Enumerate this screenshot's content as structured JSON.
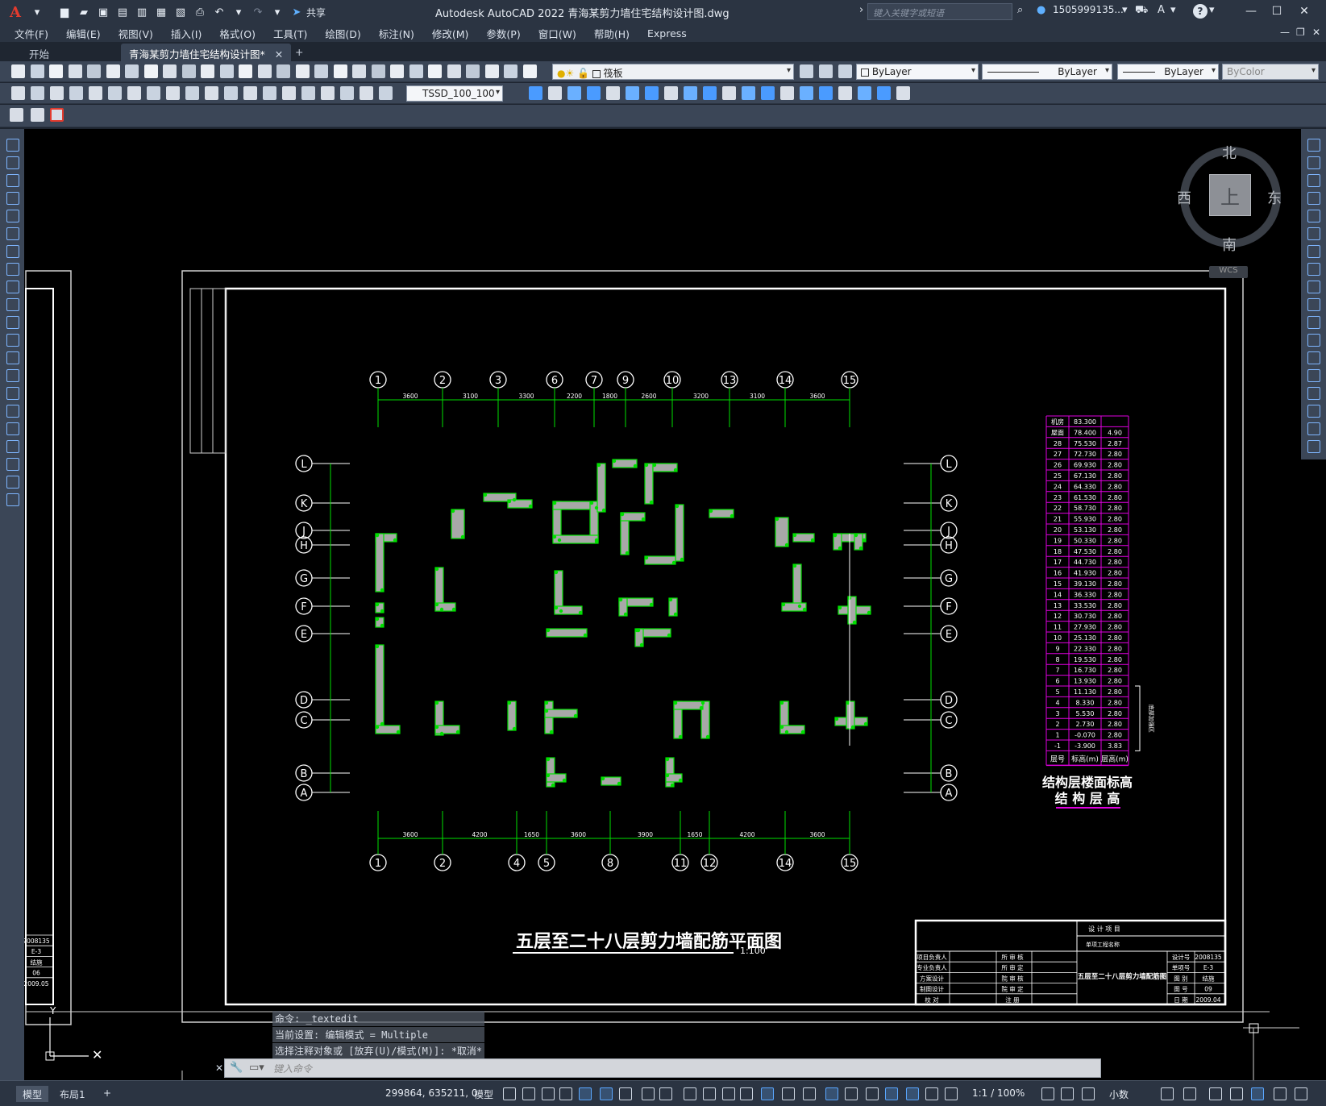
{
  "app": {
    "logo": "A",
    "title": "Autodesk AutoCAD 2022    青海某剪力墙住宅结构设计图.dwg",
    "share_label": "共享",
    "search_placeholder": "键入关键字或短语",
    "user": "1505999135...",
    "help": "?"
  },
  "menu": [
    "文件(F)",
    "编辑(E)",
    "视图(V)",
    "插入(I)",
    "格式(O)",
    "工具(T)",
    "绘图(D)",
    "标注(N)",
    "修改(M)",
    "参数(P)",
    "窗口(W)",
    "帮助(H)",
    "Express"
  ],
  "tabs": {
    "start": "开始",
    "active": "青海某剪力墙住宅结构设计图*",
    "add": "+"
  },
  "toolbar": {
    "layer_combo": "筏板",
    "text_style": "TSSD_100_100",
    "color_combo": "ByLayer",
    "linetype_combo": "ByLayer",
    "lineweight_combo": "ByLayer",
    "plotstyle_combo": "ByColor"
  },
  "viewcube": {
    "north": "北",
    "south": "南",
    "east": "东",
    "west": "西",
    "top": "上",
    "wcs": "WCS"
  },
  "drawing": {
    "title": "五层至二十八层剪力墙配筋平面图",
    "scale": "1:100",
    "grid_top": [
      "1",
      "2",
      "3",
      "6",
      "7",
      "9",
      "10",
      "13",
      "14",
      "15"
    ],
    "grid_bottom": [
      "1",
      "2",
      "4",
      "5",
      "8",
      "11",
      "12",
      "14",
      "15"
    ],
    "grid_left": [
      "L",
      "K",
      "J",
      "H",
      "G",
      "F",
      "E",
      "D",
      "C",
      "B",
      "A"
    ],
    "dims_top": [
      "3600",
      "3100",
      "3300",
      "2200",
      "1800",
      "2600",
      "3200",
      "3100",
      "3600"
    ],
    "dims_bottom": [
      "3600",
      "4200",
      "1650",
      "3600",
      "3900",
      "1650",
      "4200",
      "3600"
    ],
    "table_title_1": "结构层楼面标高",
    "table_title_2": "结 构 层 高",
    "table_headers": [
      "层号",
      "标高(m)",
      "层高(m)"
    ],
    "table_side": "底部加强区",
    "table_rows": [
      [
        "机房",
        "83.300",
        ""
      ],
      [
        "屋面",
        "78.400",
        "4.90"
      ],
      [
        "28",
        "75.530",
        "2.87"
      ],
      [
        "27",
        "72.730",
        "2.80"
      ],
      [
        "26",
        "69.930",
        "2.80"
      ],
      [
        "25",
        "67.130",
        "2.80"
      ],
      [
        "24",
        "64.330",
        "2.80"
      ],
      [
        "23",
        "61.530",
        "2.80"
      ],
      [
        "22",
        "58.730",
        "2.80"
      ],
      [
        "21",
        "55.930",
        "2.80"
      ],
      [
        "20",
        "53.130",
        "2.80"
      ],
      [
        "19",
        "50.330",
        "2.80"
      ],
      [
        "18",
        "47.530",
        "2.80"
      ],
      [
        "17",
        "44.730",
        "2.80"
      ],
      [
        "16",
        "41.930",
        "2.80"
      ],
      [
        "15",
        "39.130",
        "2.80"
      ],
      [
        "14",
        "36.330",
        "2.80"
      ],
      [
        "13",
        "33.530",
        "2.80"
      ],
      [
        "12",
        "30.730",
        "2.80"
      ],
      [
        "11",
        "27.930",
        "2.80"
      ],
      [
        "10",
        "25.130",
        "2.80"
      ],
      [
        "9",
        "22.330",
        "2.80"
      ],
      [
        "8",
        "19.530",
        "2.80"
      ],
      [
        "7",
        "16.730",
        "2.80"
      ],
      [
        "6",
        "13.930",
        "2.80"
      ],
      [
        "5",
        "11.130",
        "2.80"
      ],
      [
        "4",
        "8.330",
        "2.80"
      ],
      [
        "3",
        "5.530",
        "2.80"
      ],
      [
        "2",
        "2.730",
        "2.80"
      ],
      [
        "1",
        "-0.070",
        "2.80"
      ],
      [
        "-1",
        "-3.900",
        "3.83"
      ]
    ],
    "titleblock": {
      "design_project": "设 计 项 目",
      "sub_project": "单项工程名称",
      "rows_left": [
        "项目负责人",
        "专业负责人",
        "方案设计",
        "制图设计",
        "校   对"
      ],
      "rows_mid": [
        "所 审 核",
        "所 审 定",
        "院 审 核",
        "院 审 定",
        "注   册"
      ],
      "drawing_name": "五层至二十八层剪力墙配筋图",
      "right_labels": [
        "设计号",
        "单项号",
        "图   别",
        "图   号",
        "日   期"
      ],
      "right_values": [
        "2008135",
        "E-3",
        "结施",
        "09",
        "2009.04"
      ]
    },
    "prev_sheet_values": [
      "2008135",
      "E-3",
      "结施",
      "06",
      "2009.05"
    ]
  },
  "command": {
    "history": [
      "命令: _textedit",
      "当前设置: 编辑模式 = Multiple",
      "选择注释对象或 [放弃(U)/模式(M)]: *取消*"
    ],
    "placeholder": "键入命令"
  },
  "status": {
    "model_tab": "模型",
    "layout_tab": "布局1",
    "add_tab": "+",
    "coords": "299864, 635211, 0",
    "mode": "模型",
    "scale": "1:1 / 100%",
    "units": "小数"
  },
  "colors": {
    "drawing_green": "#00e000",
    "table_magenta": "#e000e0",
    "grid_circle": "#ffffff"
  }
}
